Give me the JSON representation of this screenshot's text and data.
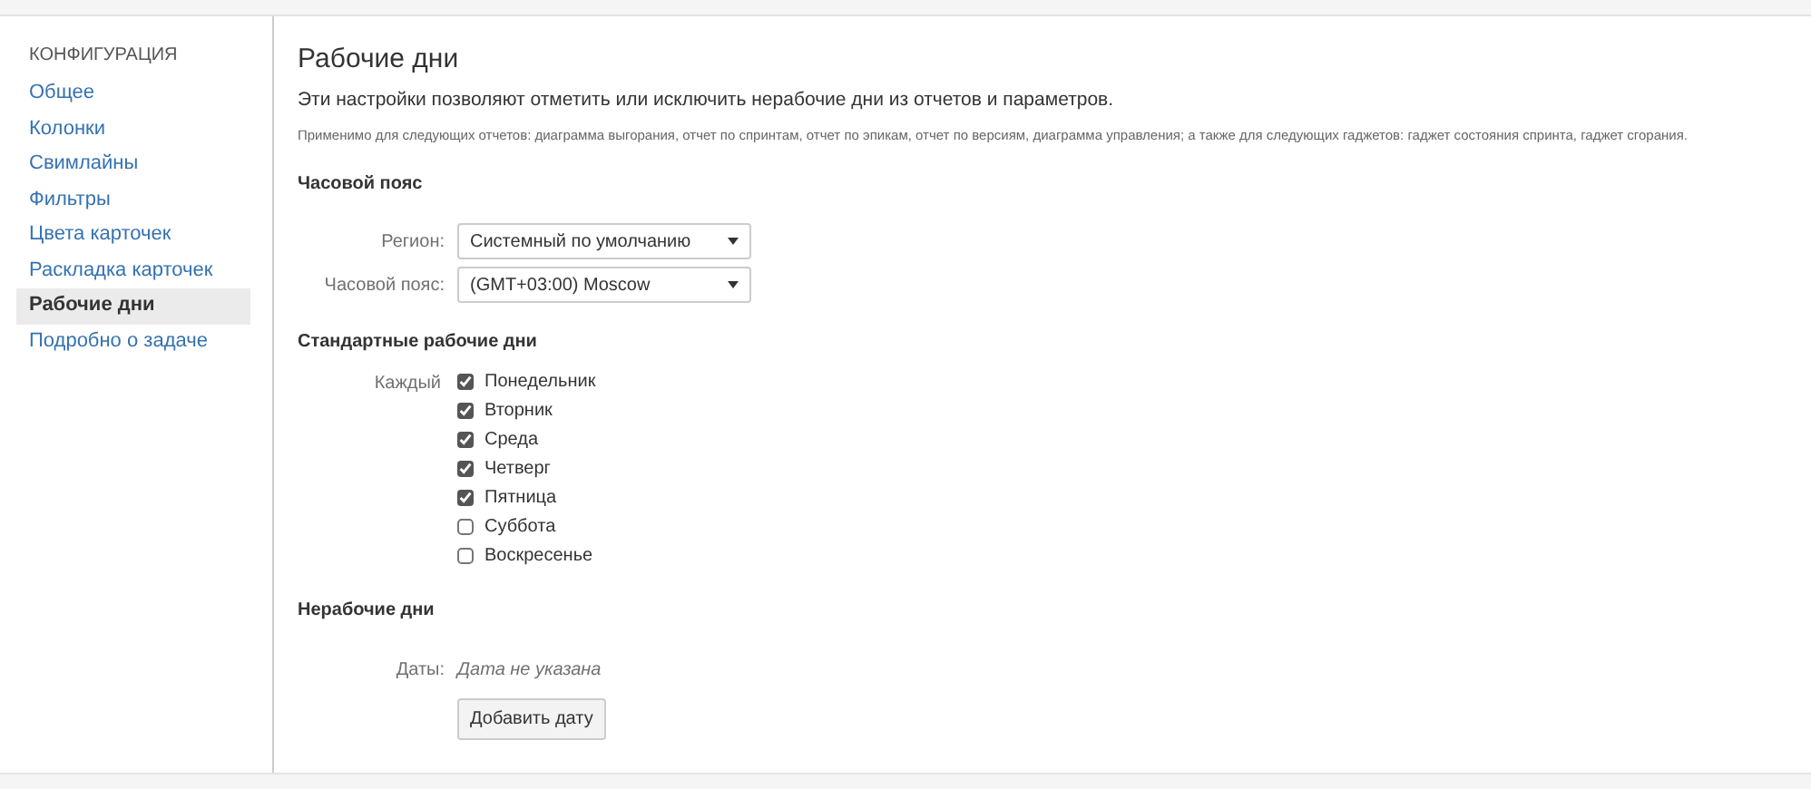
{
  "sidebar": {
    "heading": "КОНФИГУРАЦИЯ",
    "items": [
      {
        "label": "Общее",
        "selected": false
      },
      {
        "label": "Колонки",
        "selected": false
      },
      {
        "label": "Свимлайны",
        "selected": false
      },
      {
        "label": "Фильтры",
        "selected": false
      },
      {
        "label": "Цвета карточек",
        "selected": false
      },
      {
        "label": "Раскладка карточек",
        "selected": false
      },
      {
        "label": "Рабочие дни",
        "selected": true
      },
      {
        "label": "Подробно о задаче",
        "selected": false
      }
    ]
  },
  "page": {
    "title": "Рабочие дни",
    "description": "Эти настройки позволяют отметить или исключить нерабочие дни из отчетов и параметров.",
    "note": "Применимо для следующих отчетов: диаграмма выгорания, отчет по спринтам, отчет по эпикам, отчет по версиям, диаграмма управления; а также для следующих гаджетов: гаджет состояния спринта, гаджет сгорания."
  },
  "timezone": {
    "heading": "Часовой пояс",
    "fields": [
      {
        "label": "Регион:",
        "value": "Системный по умолчанию"
      },
      {
        "label": "Часовой пояс:",
        "value": "(GMT+03:00) Moscow"
      }
    ]
  },
  "working_days": {
    "heading": "Стандартные рабочие дни",
    "label": "Каждый",
    "days": [
      {
        "label": "Понедельник",
        "checked": true
      },
      {
        "label": "Вторник",
        "checked": true
      },
      {
        "label": "Среда",
        "checked": true
      },
      {
        "label": "Четверг",
        "checked": true
      },
      {
        "label": "Пятница",
        "checked": true
      },
      {
        "label": "Суббота",
        "checked": false
      },
      {
        "label": "Воскресенье",
        "checked": false
      }
    ]
  },
  "non_working_days": {
    "heading": "Нерабочие дни",
    "label": "Даты:",
    "value": "Дата не указана",
    "button": "Добавить дату"
  }
}
